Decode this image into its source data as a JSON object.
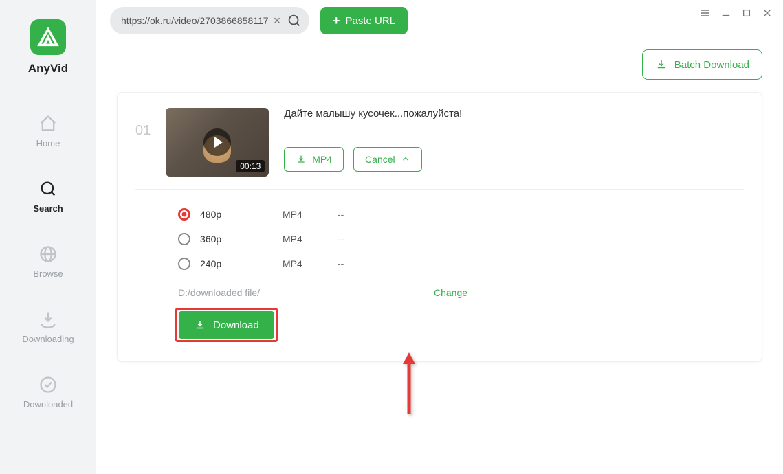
{
  "app": {
    "name": "AnyVid"
  },
  "sidebar": {
    "items": [
      {
        "id": "home",
        "label": "Home"
      },
      {
        "id": "search",
        "label": "Search"
      },
      {
        "id": "browse",
        "label": "Browse"
      },
      {
        "id": "downloading",
        "label": "Downloading"
      },
      {
        "id": "downloaded",
        "label": "Downloaded"
      }
    ],
    "active": "search"
  },
  "topbar": {
    "url_value": "https://ok.ru/video/2703866858117",
    "paste_label": "Paste URL"
  },
  "batch_label": "Batch Download",
  "result": {
    "index": "01",
    "title": "Дайте малышу кусочек...пожалуйста!",
    "duration": "00:13",
    "format_button": "MP4",
    "cancel_label": "Cancel",
    "options": [
      {
        "quality": "480p",
        "format": "MP4",
        "size": "--",
        "selected": true
      },
      {
        "quality": "360p",
        "format": "MP4",
        "size": "--",
        "selected": false
      },
      {
        "quality": "240p",
        "format": "MP4",
        "size": "--",
        "selected": false
      }
    ],
    "save_path": "D:/downloaded file/",
    "change_label": "Change",
    "download_label": "Download"
  }
}
